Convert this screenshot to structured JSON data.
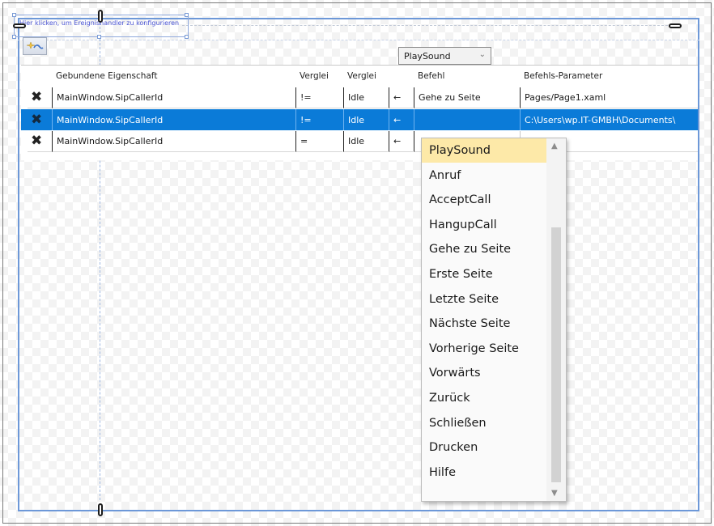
{
  "designer": {
    "hint_text": "Hier klicken, um Ereignishandler zu konfigurieren"
  },
  "toolbar": {
    "add_icon": "add-trigger-icon"
  },
  "grid": {
    "columns": [
      "",
      "Gebundene Eigenschaft",
      "Verglei",
      "Verglei",
      "",
      "Befehl",
      "Befehls-Parameter"
    ],
    "rows": [
      {
        "property": "MainWindow.SipCallerId",
        "operator": "!=",
        "value": "Idle",
        "arrow": "←",
        "command": "Gehe zu Seite",
        "parameter": "Pages/Page1.xaml",
        "selected": false
      },
      {
        "property": "MainWindow.SipCallerId",
        "operator": "!=",
        "value": "Idle",
        "arrow": "←",
        "command": "PlaySound",
        "parameter": "C:\\Users\\wp.IT-GMBH\\Documents\\",
        "selected": true
      },
      {
        "property": "MainWindow.SipCallerId",
        "operator": "=",
        "value": "Idle",
        "arrow": "←",
        "command": "",
        "parameter": "",
        "selected": false
      }
    ]
  },
  "dropdown": {
    "selected": "PlaySound",
    "options": [
      "PlaySound",
      "Anruf",
      "AcceptCall",
      "HangupCall",
      "Gehe zu Seite",
      "Erste Seite",
      "Letzte Seite",
      "Nächste Seite",
      "Vorherige Seite",
      "Vorwärts",
      "Zurück",
      "Schließen",
      "Drucken",
      "Hilfe"
    ]
  },
  "colors": {
    "selection": "#0b7bd8",
    "highlight": "#fde9a8",
    "designer_border": "#6d98d8"
  }
}
